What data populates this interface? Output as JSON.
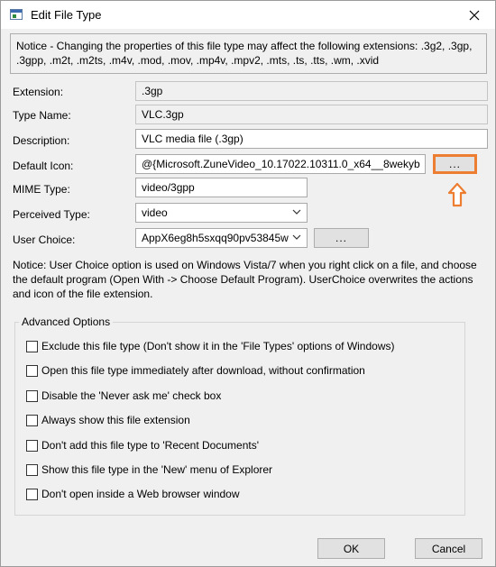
{
  "window": {
    "title": "Edit File Type"
  },
  "notice": "Notice - Changing the properties of this file type may affect the following extensions: .3g2, .3gp, .3gpp, .m2t, .m2ts, .m4v, .mod, .mov, .mp4v, .mpv2, .mts, .ts, .tts, .wm, .xvid",
  "form": {
    "extension": {
      "label": "Extension:",
      "value": ".3gp"
    },
    "type_name": {
      "label": "Type Name:",
      "value": "VLC.3gp"
    },
    "description": {
      "label": "Description:",
      "value": "VLC media file (.3gp)"
    },
    "default_icon": {
      "label": "Default Icon:",
      "value": "@{Microsoft.ZuneVideo_10.17022.10311.0_x64__8wekyb",
      "browse_label": "..."
    },
    "mime_type": {
      "label": "MIME Type:",
      "value": "video/3gpp"
    },
    "perceived_type": {
      "label": "Perceived Type:",
      "value": "video"
    },
    "user_choice": {
      "label": "User Choice:",
      "value": "AppX6eg8h5sxqq90pv53845w",
      "browse_label": "..."
    }
  },
  "user_choice_notice": "Notice: User Choice option is used on Windows Vista/7 when you right click on a file, and choose the default program (Open With -> Choose Default Program). UserChoice overwrites the actions and icon of the file extension.",
  "advanced": {
    "title": "Advanced Options",
    "options": [
      {
        "label": "Exclude  this file type (Don't show it in the 'File Types' options of Windows)",
        "checked": false
      },
      {
        "label": "Open this file type immediately after download, without confirmation",
        "checked": false
      },
      {
        "label": "Disable the 'Never ask me' check box",
        "checked": false
      },
      {
        "label": "Always show this file extension",
        "checked": false
      },
      {
        "label": "Don't add this file type to 'Recent Documents'",
        "checked": false
      },
      {
        "label": "Show this file type in the 'New' menu of Explorer",
        "checked": false
      },
      {
        "label": "Don't open inside a Web browser window",
        "checked": false
      }
    ]
  },
  "buttons": {
    "ok": "OK",
    "cancel": "Cancel"
  },
  "colors": {
    "highlight": "#ed7d31",
    "window_bg": "#f0f0f0"
  },
  "icons": {
    "arrow": "arrow-up-icon",
    "close": "close-icon",
    "chevron": "chevron-down-icon"
  }
}
